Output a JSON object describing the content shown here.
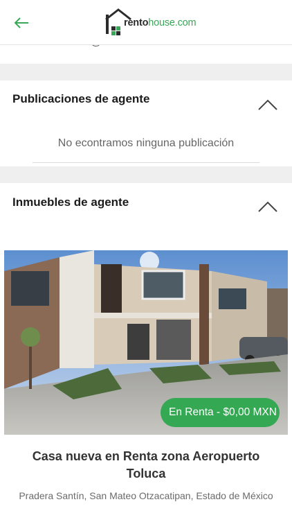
{
  "header": {
    "back_icon": "arrow-left-icon",
    "logo": {
      "part1": "rento",
      "part2": "house.com"
    },
    "accent_color": "#3aa657"
  },
  "partial_email": "cristinamroach@rentohouse.com",
  "publications_section": {
    "title": "Publicaciones de agente",
    "empty_message": "No econtramos ninguna publicación",
    "toggle_icon": "chevron-up-icon"
  },
  "properties_section": {
    "title": "Inmuebles de agente",
    "toggle_icon": "chevron-up-icon"
  },
  "listing": {
    "badge": "En Renta - $0,00 MXN",
    "badge_color": "#34a853",
    "title": "Casa nueva en Renta zona Aeropuerto Toluca",
    "address": "Pradera Santín, San Mateo Otzacatipan, Estado de México"
  }
}
